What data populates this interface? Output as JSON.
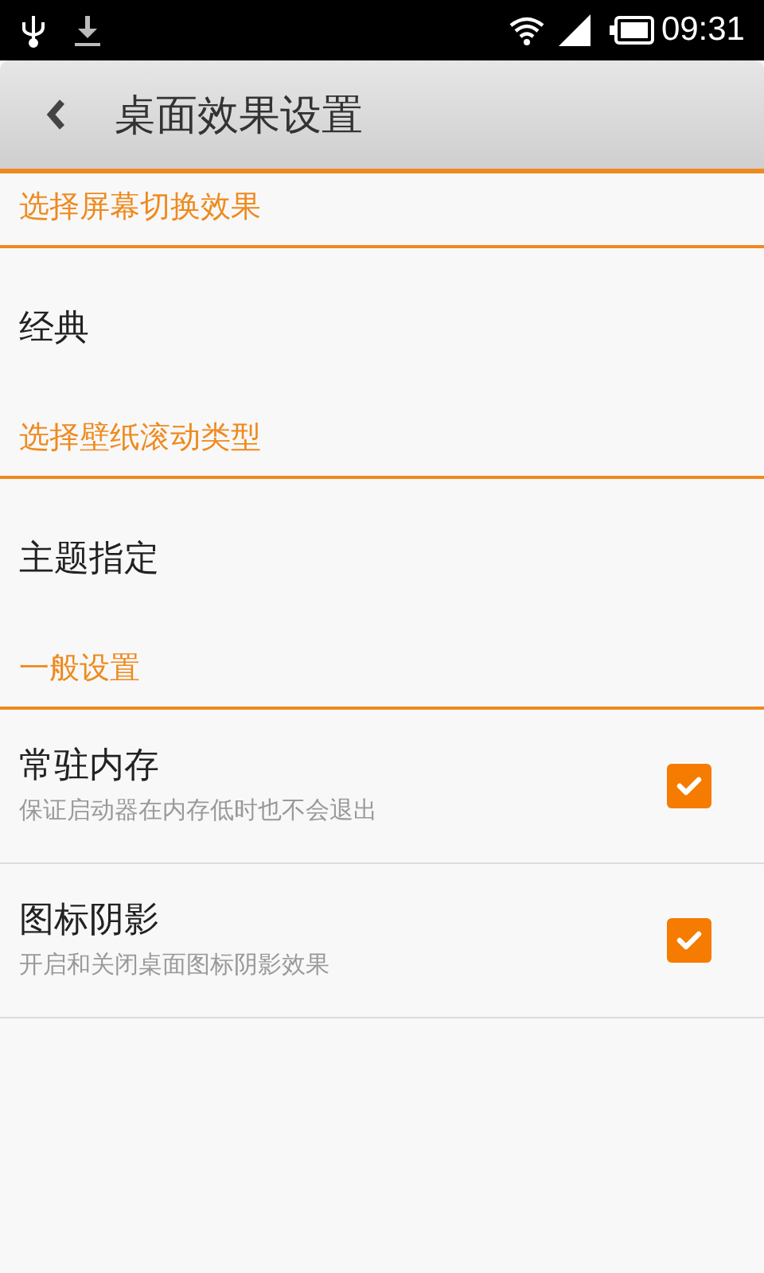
{
  "status_bar": {
    "time": "09:31"
  },
  "header": {
    "title": "桌面效果设置"
  },
  "sections": [
    {
      "title": "选择屏幕切换效果",
      "items": [
        {
          "kind": "value",
          "title": "经典"
        }
      ]
    },
    {
      "title": "选择壁纸滚动类型",
      "items": [
        {
          "kind": "value",
          "title": "主题指定"
        }
      ]
    },
    {
      "title": "一般设置",
      "items": [
        {
          "kind": "check",
          "title": "常驻内存",
          "summary": "保证启动器在内存低时也不会退出",
          "checked": true
        },
        {
          "kind": "check",
          "title": "图标阴影",
          "summary": "开启和关闭桌面图标阴影效果",
          "checked": true
        }
      ]
    }
  ]
}
